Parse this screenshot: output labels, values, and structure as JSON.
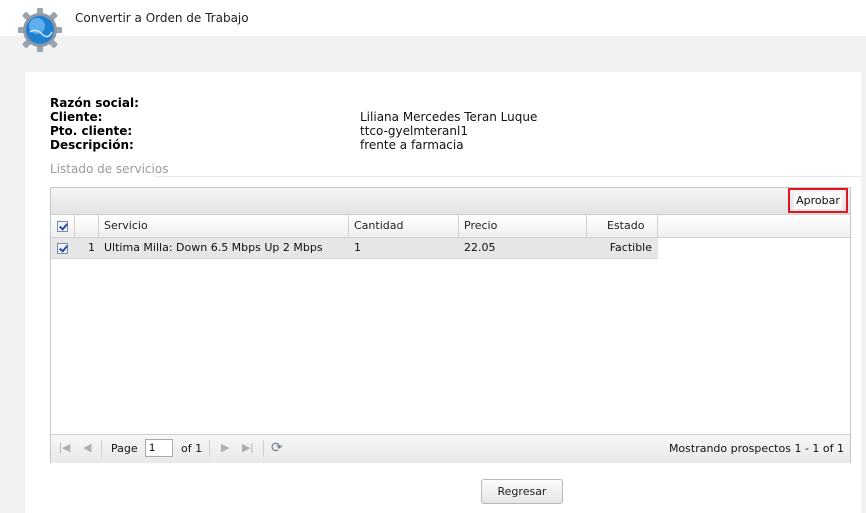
{
  "header": {
    "title": "Convertir a Orden de Trabajo",
    "logo_icon": "gear-globe-icon"
  },
  "info": {
    "razon_social_label": "Razón social:",
    "razon_social_value": "",
    "cliente_label": "Cliente:",
    "cliente_value": "Liliana Mercedes Teran Luque",
    "pto_cliente_label": "Pto. cliente:",
    "pto_cliente_value": "ttco-gyelmteranl1",
    "descripcion_label": "Descripción:",
    "descripcion_value": "frente a farmacia"
  },
  "section_title": "Listado de servicios",
  "toolbar": {
    "aprobar_label": "Aprobar",
    "highlight_color": "#e3141f"
  },
  "grid": {
    "columns": [
      "Servicio",
      "Cantidad",
      "Precio",
      "Estado"
    ],
    "header_checked": true,
    "rows": [
      {
        "checked": true,
        "num": "1",
        "servicio": "Ultima Milla: Down 6.5 Mbps Up 2 Mbps",
        "cantidad": "1",
        "precio": "22.05",
        "estado": "Factible"
      }
    ]
  },
  "pager": {
    "page_label": "Page",
    "page_value": "1",
    "of_label": "of 1",
    "status": "Mostrando prospectos 1 - 1 of 1"
  },
  "footer": {
    "regresar_label": "Regresar"
  }
}
